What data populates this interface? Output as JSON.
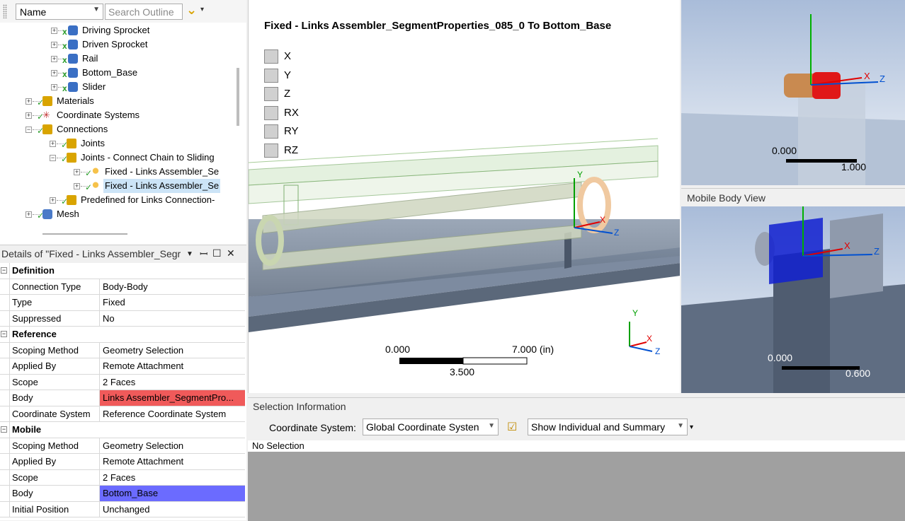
{
  "outline": {
    "sort_field": "Name",
    "search_placeholder": "Search Outline",
    "items": [
      {
        "label": "Driving Sprocket",
        "level": 4,
        "icon": "body-icon",
        "check": "x"
      },
      {
        "label": "Driven Sprocket",
        "level": 4,
        "icon": "body-icon",
        "check": "x"
      },
      {
        "label": "Rail",
        "level": 4,
        "icon": "body-icon",
        "check": "x"
      },
      {
        "label": "Bottom_Base",
        "level": 4,
        "icon": "body-icon",
        "check": "x"
      },
      {
        "label": "Slider",
        "level": 4,
        "icon": "body-icon",
        "check": "x"
      },
      {
        "label": "Materials",
        "level": 2,
        "icon": "materials-icon",
        "check": "ok"
      },
      {
        "label": "Coordinate Systems",
        "level": 2,
        "icon": "coordinate-systems-icon",
        "check": "ok"
      },
      {
        "label": "Connections",
        "level": 2,
        "icon": "connections-icon",
        "check": "ok"
      },
      {
        "label": "Joints",
        "level": 3,
        "icon": "folder-icon",
        "check": "ok"
      },
      {
        "label": "Joints - Connect Chain to Sliding",
        "level": 3,
        "icon": "folder-icon",
        "check": "ok"
      },
      {
        "label": "Fixed - Links Assembler_Se",
        "level": 4,
        "icon": "joint-icon",
        "check": "ok"
      },
      {
        "label": "Fixed - Links Assembler_Se",
        "level": 4,
        "icon": "joint-icon",
        "check": "ok",
        "selected": true
      },
      {
        "label": "Predefined for Links Connection-",
        "level": 3,
        "icon": "folder-icon",
        "check": "ok"
      },
      {
        "label": "Mesh",
        "level": 2,
        "icon": "mesh-icon",
        "check": "ok"
      }
    ]
  },
  "details": {
    "title": "Details of \"Fixed - Links Assembler_Segr",
    "rows": [
      {
        "type": "section",
        "label": "Definition"
      },
      {
        "label": "Connection Type",
        "value": "Body-Body"
      },
      {
        "label": "Type",
        "value": "Fixed"
      },
      {
        "label": "Suppressed",
        "value": "No"
      },
      {
        "type": "section",
        "label": "Reference"
      },
      {
        "label": "Scoping Method",
        "value": "Geometry Selection"
      },
      {
        "label": "Applied By",
        "value": "Remote Attachment"
      },
      {
        "label": "Scope",
        "value": "2 Faces"
      },
      {
        "label": "Body",
        "value": "Links Assembler_SegmentPro...",
        "highlight": "#f05a5a"
      },
      {
        "label": "Coordinate System",
        "value": "Reference Coordinate System"
      },
      {
        "type": "section",
        "label": "Mobile"
      },
      {
        "label": "Scoping Method",
        "value": "Geometry Selection"
      },
      {
        "label": "Applied By",
        "value": "Remote Attachment"
      },
      {
        "label": "Scope",
        "value": "2 Faces"
      },
      {
        "label": "Body",
        "value": "Bottom_Base",
        "highlight": "#6b6bff"
      },
      {
        "label": "Initial Position",
        "value": "Unchanged"
      }
    ]
  },
  "viewport": {
    "title": "Fixed - Links Assembler_SegmentProperties_085_0 To Bottom_Base",
    "dofs": [
      "X",
      "Y",
      "Z",
      "RX",
      "RY",
      "RZ"
    ],
    "scale": {
      "start": "0.000",
      "end": "7.000 (in)",
      "mid": "3.500"
    },
    "triad": {
      "y": "Y",
      "x": "X",
      "z": "Z"
    }
  },
  "reference_view": {
    "scale": {
      "start": "0.000",
      "end": "1.000"
    },
    "triad": {
      "x": "X",
      "z": "Z"
    }
  },
  "mobile_view": {
    "title": "Mobile Body View",
    "scale": {
      "start": "0.000",
      "end": "0.600"
    },
    "triad": {
      "x": "X",
      "z": "Z"
    }
  },
  "selection_info": {
    "title": "Selection Information",
    "coordinate_label": "Coordinate System:",
    "coordinate_value": "Global Coordinate Systen",
    "display_mode": "Show Individual and Summary",
    "status": "No Selection"
  },
  "colors": {
    "reference_body": "#f05a5a",
    "mobile_body": "#6b6bff",
    "check_green": "#2a9d2a",
    "axis_x": "#e00000",
    "axis_y": "#00a000",
    "axis_z": "#0050d0"
  }
}
